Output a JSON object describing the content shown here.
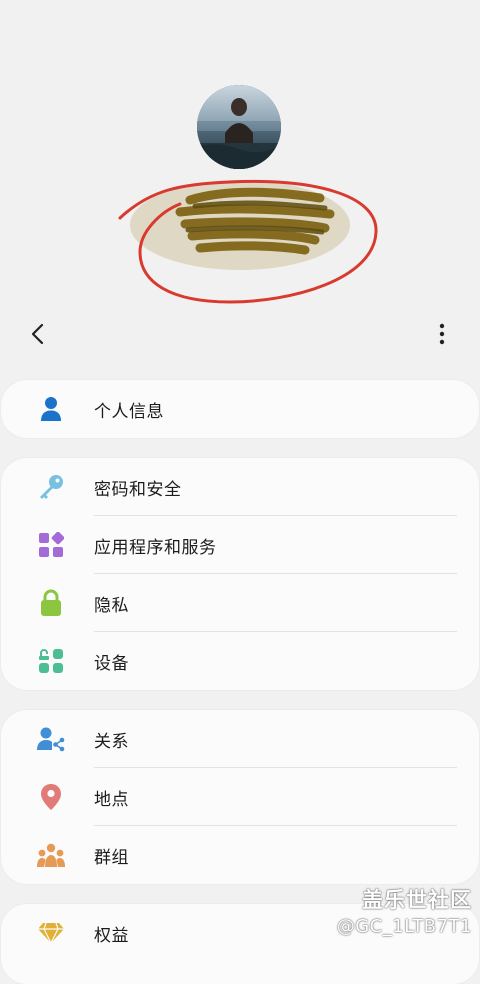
{
  "menu": {
    "group1": [
      {
        "label": "个人信息",
        "icon": "person-icon",
        "color": "#1a72c9"
      }
    ],
    "group2": [
      {
        "label": "密码和安全",
        "icon": "key-icon",
        "color": "#78c0df"
      },
      {
        "label": "应用程序和服务",
        "icon": "apps-icon",
        "color": "#a46bd8"
      },
      {
        "label": "隐私",
        "icon": "lock-icon",
        "color": "#8cc63f"
      },
      {
        "label": "设备",
        "icon": "devices-icon",
        "color": "#4dbd94"
      }
    ],
    "group3": [
      {
        "label": "关系",
        "icon": "share-person-icon",
        "color": "#3f8ed6"
      },
      {
        "label": "地点",
        "icon": "location-pin-icon",
        "color": "#e07b77"
      },
      {
        "label": "群组",
        "icon": "group-icon",
        "color": "#e59a55"
      }
    ],
    "group4": [
      {
        "label": "权益",
        "icon": "diamond-icon",
        "color": "#e0b136"
      }
    ]
  },
  "watermark": {
    "brand": "盖乐世社区",
    "user": "@GC_1LTB7T1"
  }
}
